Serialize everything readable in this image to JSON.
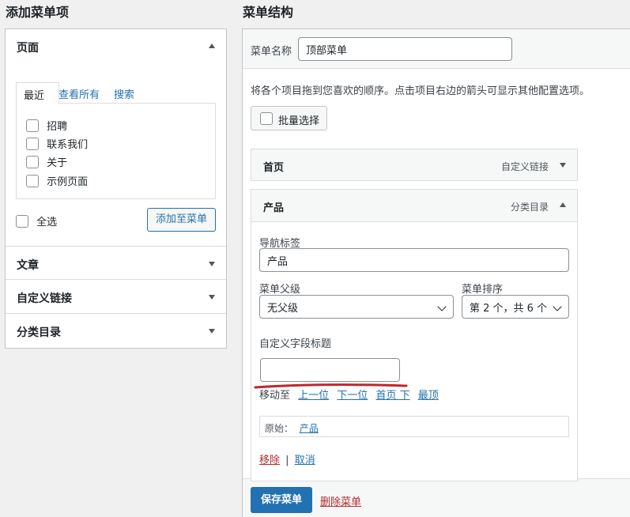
{
  "left": {
    "heading": "添加菜单项",
    "pages_section": {
      "title": "页面",
      "tabs": [
        "最近",
        "查看所有",
        "搜索"
      ],
      "items": [
        "招聘",
        "联系我们",
        "关于",
        "示例页面"
      ],
      "select_all": "全选",
      "add_button": "添加至菜单"
    },
    "other_sections": [
      "文章",
      "自定义链接",
      "分类目录"
    ]
  },
  "right": {
    "heading": "菜单结构",
    "menu_name_label": "菜单名称",
    "menu_name_value": "顶部菜单",
    "instructions": "将各个项目拖到您喜欢的顺序。点击项目右边的箭头可显示其他配置选项。",
    "bulk_select": "批量选择",
    "items": [
      {
        "title": "首页",
        "type": "自定义链接"
      },
      {
        "title": "产品",
        "type": "分类目录"
      }
    ],
    "item_settings": {
      "nav_label_label": "导航标签",
      "nav_label_value": "产品",
      "parent_label": "菜单父级",
      "parent_value": "无父级",
      "order_label": "菜单排序",
      "order_value": "第 2 个，共 6 个",
      "custom_field_label": "自定义字段标题",
      "custom_field_value": "",
      "move_label": "移动至",
      "move_links": [
        "上一位",
        "下一位",
        "首页 下",
        "最顶"
      ],
      "original_label": "原始：",
      "original_link": "产品",
      "remove": "移除",
      "separator": "|",
      "cancel": "取消"
    },
    "save_button": "保存菜单",
    "delete_link": "删除菜单"
  },
  "colors": {
    "primary": "#2271b1",
    "danger": "#b32d2e",
    "annotation": "#c0262d"
  }
}
